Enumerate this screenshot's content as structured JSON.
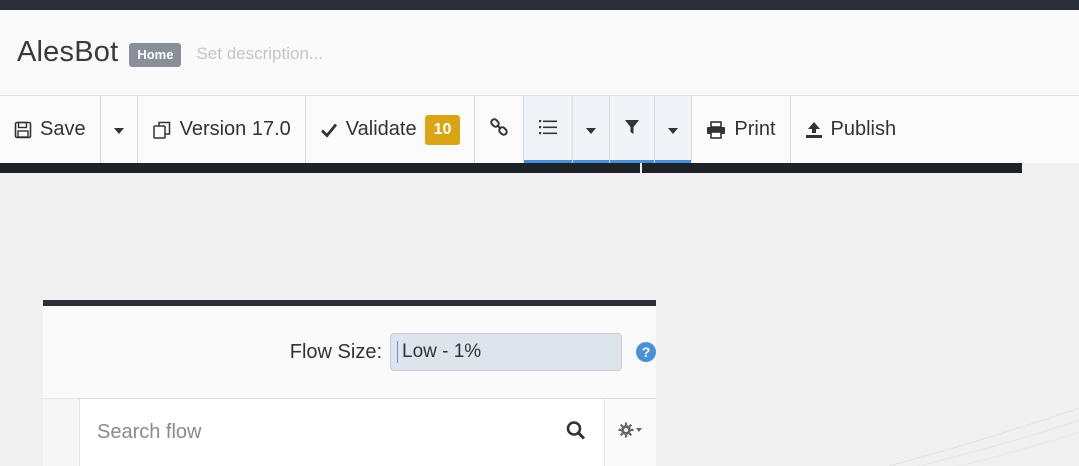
{
  "app": {
    "title": "AlesBot",
    "badge": "Home",
    "description_placeholder": "Set description..."
  },
  "toolbar": {
    "save_label": "Save",
    "version_label": "Version 17.0",
    "validate_label": "Validate",
    "validate_count": "10",
    "print_label": "Print",
    "publish_label": "Publish"
  },
  "flow": {
    "size_label": "Flow Size:",
    "size_value": "Low - 1%",
    "search_placeholder": "Search flow"
  },
  "colors": {
    "accent": "#4a90d9",
    "badge_warning": "#d9a514",
    "home_badge": "#8a9099",
    "dark_bar": "#2b2f36"
  }
}
